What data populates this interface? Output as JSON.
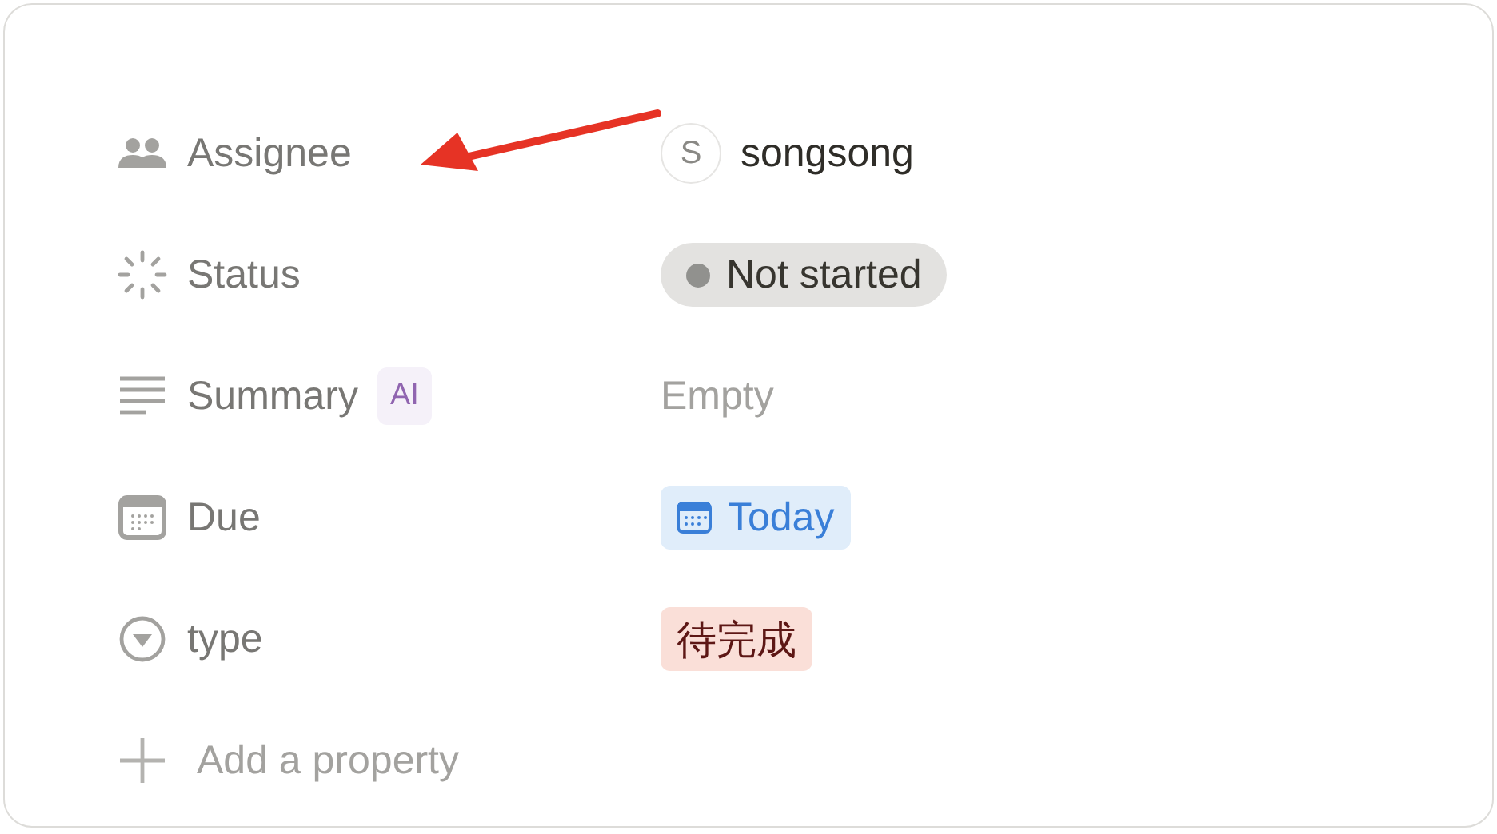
{
  "properties": [
    {
      "kind": "person",
      "label": "Assignee",
      "initial": "S",
      "value": "songsong"
    },
    {
      "kind": "status",
      "label": "Status",
      "value": "Not started",
      "color": "#91918e"
    },
    {
      "kind": "text",
      "label": "Summary",
      "badge": "AI",
      "placeholder": "Empty"
    },
    {
      "kind": "date",
      "label": "Due",
      "value": "Today"
    },
    {
      "kind": "select",
      "label": "type",
      "value": "待完成",
      "color": "#fadfd8"
    }
  ],
  "add_property": {
    "label": "Add a property"
  }
}
